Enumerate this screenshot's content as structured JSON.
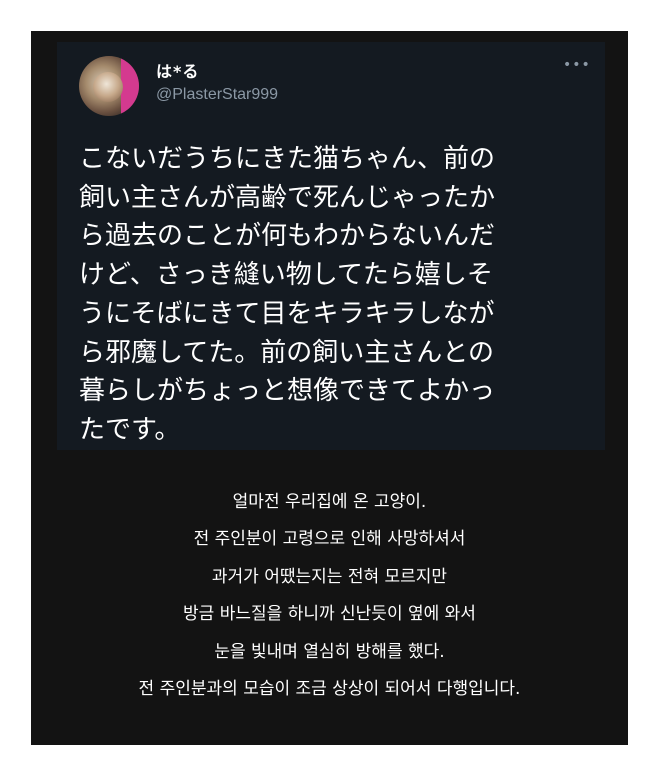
{
  "tweet": {
    "display_name": "は*る",
    "handle": "@PlasterStar999",
    "more_icon": "more-horizontal-icon",
    "more_glyph": "•••",
    "body_lines": [
      "こないだうちにきた猫ちゃん、前の",
      "飼い主さんが高齢で死んじゃったか",
      "ら過去のことが何もわからないんだ",
      "けど、さっき縫い物してたら嬉しそ",
      "うにそばにきて目をキラキラしなが",
      "ら邪魔してた。前の飼い主さんとの",
      "暮らしがちょっと想像できてよかっ",
      "たです。"
    ]
  },
  "translation": {
    "lines": [
      "얼마전 우리집에 온 고양이.",
      "전 주인분이 고령으로 인해 사망하셔서",
      "과거가 어땠는지는 전혀 모르지만",
      "방금 바느질을 하니까 신난듯이 옆에 와서",
      "눈을 빛내며 열심히 방해를 했다.",
      "전 주인분과의 모습이 조금 상상이 되어서 다행입니다."
    ]
  },
  "colors": {
    "background": "#131313",
    "card": "#141a21",
    "text": "#ffffff",
    "muted": "#8b98a5"
  }
}
